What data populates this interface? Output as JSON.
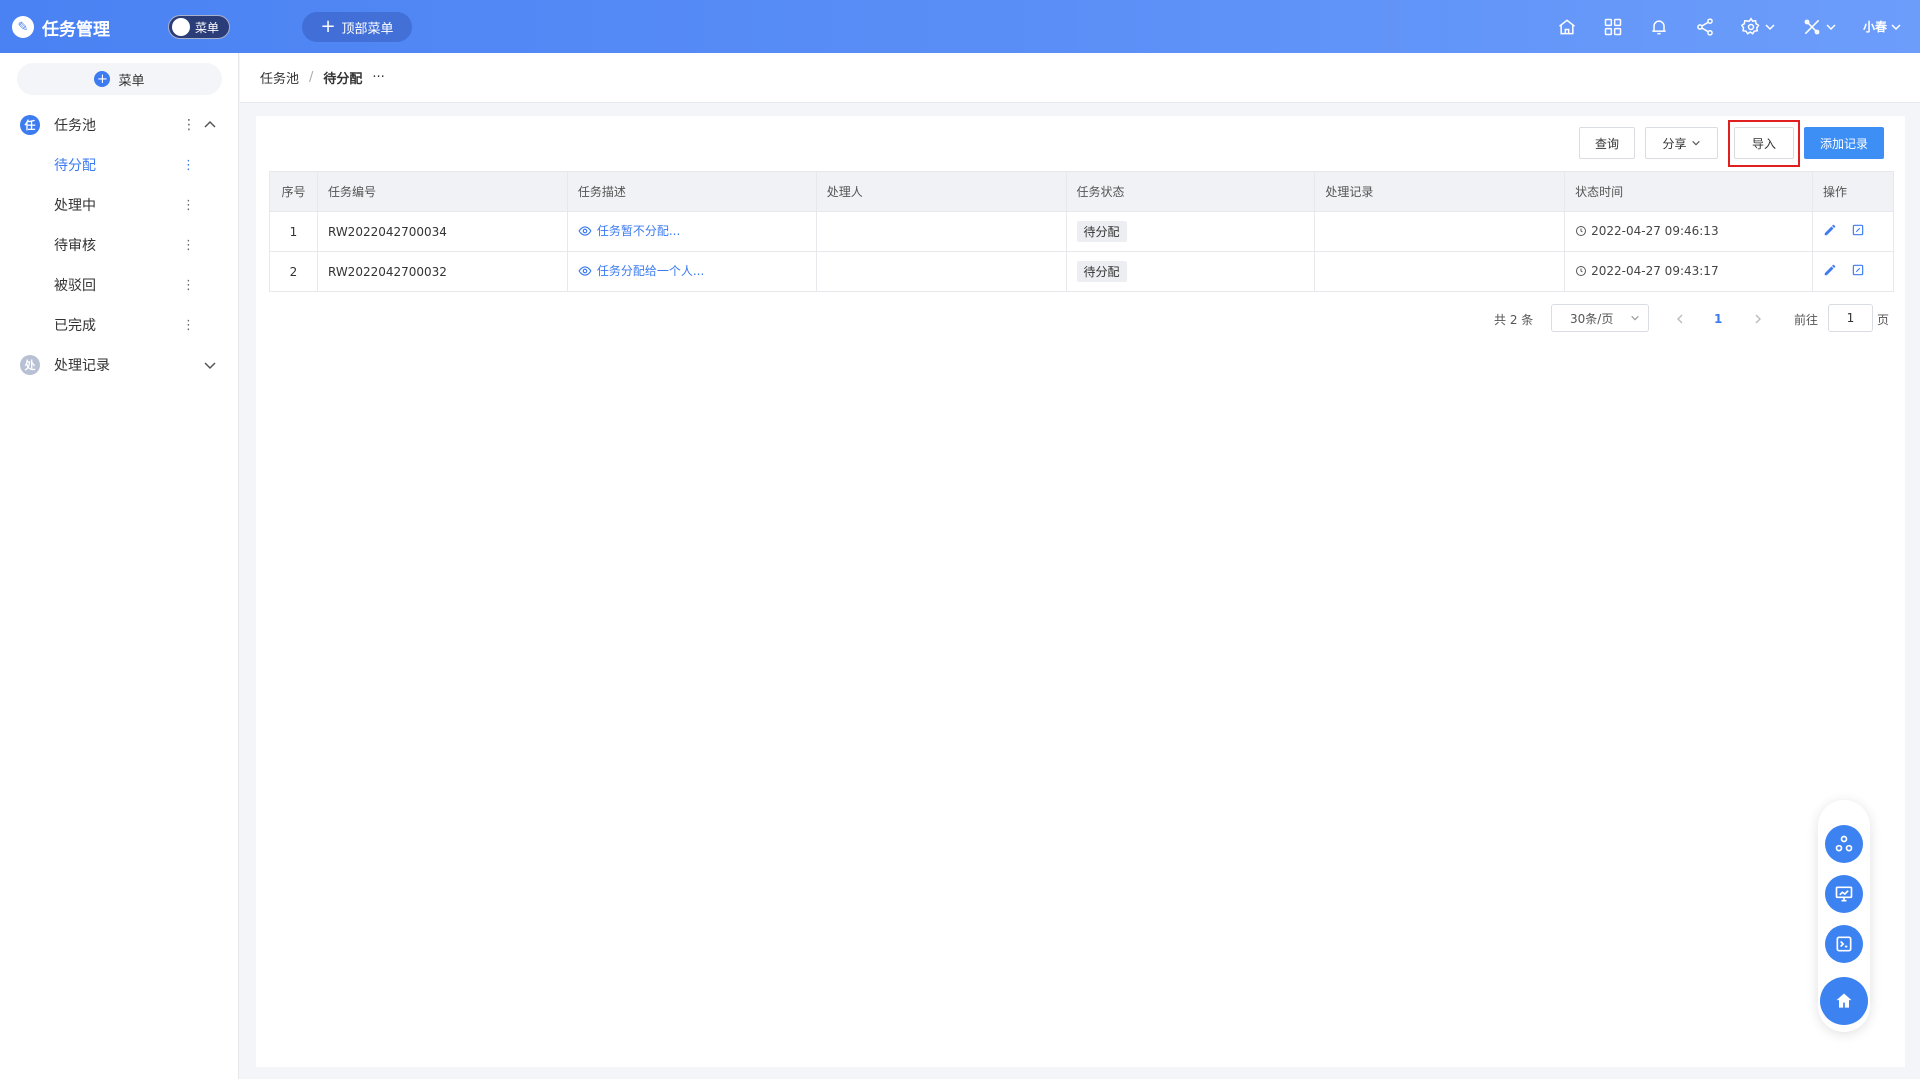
{
  "app": {
    "title": "任务管理",
    "logo_char": "✎"
  },
  "header": {
    "menu_switch_label": "菜单",
    "top_menu_label": "顶部菜单",
    "user_name": "小春"
  },
  "sidebar": {
    "menu_button_label": "菜单",
    "groups": [
      {
        "icon_char": "任",
        "label": "任务池",
        "expanded": true
      },
      {
        "icon_char": "处",
        "label": "处理记录",
        "expanded": false
      }
    ],
    "items": [
      {
        "label": "待分配",
        "active": true
      },
      {
        "label": "处理中"
      },
      {
        "label": "待审核"
      },
      {
        "label": "被驳回"
      },
      {
        "label": "已完成"
      }
    ]
  },
  "breadcrumb": {
    "parent": "任务池",
    "separator": "/",
    "current": "待分配",
    "more": "···"
  },
  "toolbar": {
    "query_label": "查询",
    "share_label": "分享",
    "import_label": "导入",
    "add_label": "添加记录"
  },
  "table": {
    "columns": [
      "序号",
      "任务编号",
      "任务描述",
      "处理人",
      "任务状态",
      "处理记录",
      "状态时间",
      "操作"
    ],
    "rows": [
      {
        "idx": "1",
        "code": "RW2022042700034",
        "desc": "任务暂不分配...",
        "handler": "",
        "status": "待分配",
        "record": "",
        "time": "2022-04-27 09:46:13"
      },
      {
        "idx": "2",
        "code": "RW2022042700032",
        "desc": "任务分配给一个人...",
        "handler": "",
        "status": "待分配",
        "record": "",
        "time": "2022-04-27 09:43:17"
      }
    ]
  },
  "pagination": {
    "total_text": "共 2 条",
    "page_size": "30条/页",
    "current_page": "1",
    "goto_label": "前往",
    "goto_value": "1",
    "page_unit": "页"
  },
  "colors": {
    "primary": "#3c7bf0",
    "header": "#4a82f3",
    "highlight": "#e02020"
  }
}
